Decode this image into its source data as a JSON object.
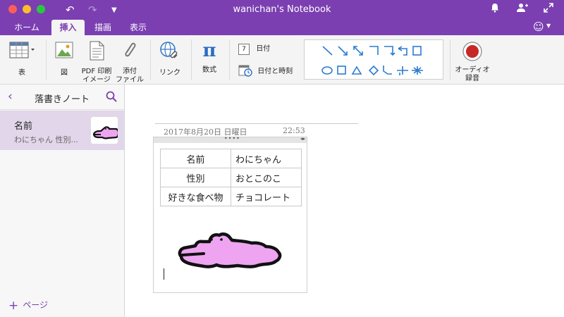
{
  "window": {
    "title": "wanichan's Notebook"
  },
  "titlebar_icons": {
    "undo": "undo-icon",
    "redo": "redo-icon",
    "bell": "notification-bell-icon",
    "share": "share-person-add-icon",
    "fullscreen": "fullscreen-icon"
  },
  "tabs": [
    {
      "label": "ホーム",
      "active": false
    },
    {
      "label": "挿入",
      "active": true
    },
    {
      "label": "描画",
      "active": false
    },
    {
      "label": "表示",
      "active": false
    }
  ],
  "ribbon": {
    "table": "表",
    "picture": "図",
    "pdf_line1": "PDF 印刷",
    "pdf_line2": "イメージ",
    "attach_line1": "添付",
    "attach_line2": "ファイル",
    "link": "リンク",
    "equation": "数式",
    "date": "日付",
    "date_icon_number": "7",
    "date_time": "日付と時刻",
    "audio_line1": "オーディオ",
    "audio_line2": "録音"
  },
  "sidebar": {
    "title": "落書きノート",
    "pages": [
      {
        "title": "名前",
        "subtitle": "わにちゃん  性別..."
      }
    ],
    "add_page": "ページ"
  },
  "page": {
    "date": "2017年8月20日 日曜日",
    "time": "22:53",
    "table": [
      [
        "名前",
        "わにちゃん"
      ],
      [
        "性別",
        "おとこのこ"
      ],
      [
        "好きな食べ物",
        "チョコレート"
      ]
    ]
  },
  "colors": {
    "accent": "#7b3fb1",
    "crocodile_fill": "#eea4f0",
    "shape_blue": "#2b7bd0",
    "record_red": "#c62828"
  }
}
